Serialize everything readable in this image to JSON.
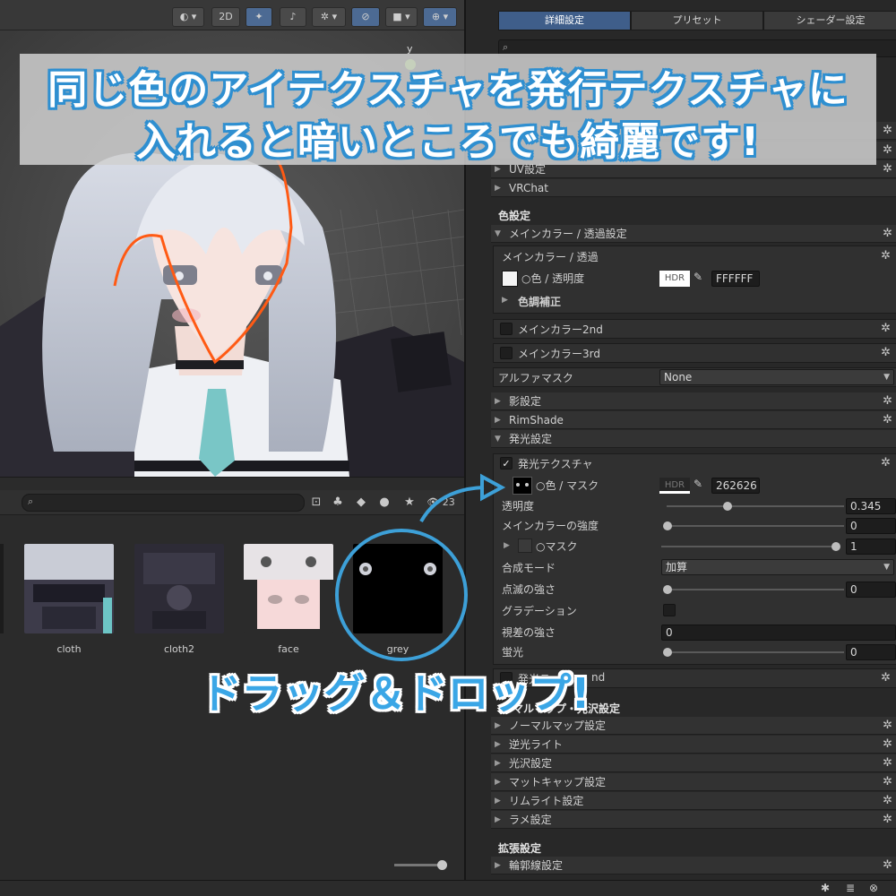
{
  "scene": {
    "toolbar": {
      "mode_2d": "2D",
      "gizmo_label": "y"
    }
  },
  "project": {
    "visible_count": "23",
    "assets": [
      {
        "name": "cloth"
      },
      {
        "name": "cloth2"
      },
      {
        "name": "face"
      },
      {
        "name": "grey"
      }
    ]
  },
  "inspector": {
    "tabs": [
      {
        "label": "詳細設定"
      },
      {
        "label": "プリセット"
      },
      {
        "label": "シェーダー設定"
      }
    ],
    "top_sections": {
      "uv": "UV設定",
      "vrchat": "VRChat"
    },
    "color_section_title": "色設定",
    "main_color": {
      "fold_label": "メインカラー / 透過設定",
      "box_title": "メインカラー / 透過",
      "color_label": "○色 / 透明度",
      "hdr": "HDR",
      "hex": "FFFFFF",
      "color_correction": "色調補正",
      "second": "メインカラー2nd",
      "third": "メインカラー3rd",
      "alpha_mask_label": "アルファマスク",
      "alpha_mask_value": "None"
    },
    "sections_mid": [
      {
        "label": "影設定"
      },
      {
        "label": "RimShade"
      },
      {
        "label": "発光設定"
      }
    ],
    "emission": {
      "box_title": "発光テクスチャ",
      "color_label": "○色 / マスク",
      "hdr": "HDR",
      "hex": "262626",
      "rows": [
        {
          "label": "透明度",
          "value": "0.345",
          "fraction": 0.345
        },
        {
          "label": "メインカラーの強度",
          "value": "0",
          "fraction": 0
        },
        {
          "label": "○マスク",
          "value": "1",
          "fraction": 1
        }
      ],
      "blend_mode_label": "合成モード",
      "blend_mode_value": "加算",
      "blink_label": "点滅の強さ",
      "blink_value": "0",
      "gradation_label": "グラデーション",
      "parallax_label": "視差の強さ",
      "parallax_value": "0",
      "fluorescence_label": "蛍光",
      "fluorescence_value": "0",
      "second_fragment": "発光テ",
      "second_suffix": "nd"
    },
    "normal_section_title_fragment": "マルマップ・光沢設定",
    "sections_bottom": [
      {
        "label": "ノーマルマップ設定"
      },
      {
        "label": "逆光ライト"
      },
      {
        "label": "光沢設定"
      },
      {
        "label": "マットキャップ設定"
      },
      {
        "label": "リムライト設定"
      },
      {
        "label": "ラメ設定"
      }
    ],
    "extended_title": "拡張設定",
    "outline": "輪郭線設定"
  },
  "annotations": {
    "banner_line1": "同じ色のアイテクスチャを発行テクスチャに",
    "banner_line2": "入れると暗いところでも綺麗です!",
    "drag_caption": "ドラッグ＆ドロップ!"
  },
  "colors": {
    "accent_blue": "#3da0d8",
    "selection_orange": "#ff5a14",
    "unity_tab_active": "#3f5e8a"
  }
}
